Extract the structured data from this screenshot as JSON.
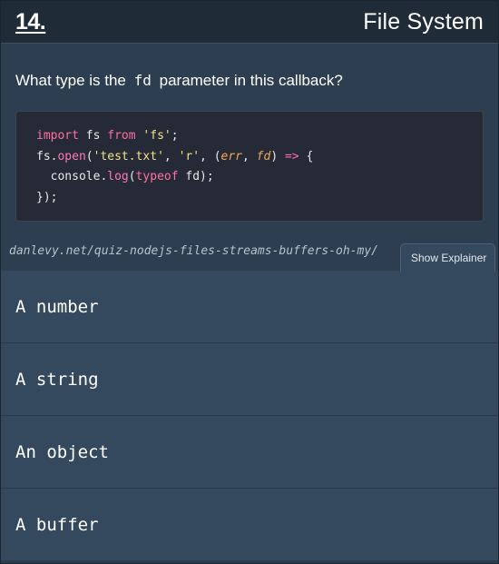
{
  "header": {
    "number": "14.",
    "topic": "File System"
  },
  "question": {
    "before": "What type is the",
    "code_term": "fd",
    "after": "parameter in this callback?"
  },
  "code": {
    "line1": {
      "kw1": "import",
      "mid1": " fs ",
      "kw2": "from",
      "sp": " ",
      "str": "'fs'",
      "end": ";"
    },
    "line2": {
      "obj": "fs.",
      "fn": "open",
      "p1": "(",
      "s1": "'test.txt'",
      "c1": ", ",
      "s2": "'r'",
      "c2": ", (",
      "a1": "err",
      "c3": ", ",
      "a2": "fd",
      "c4": ") ",
      "arrow": "=>",
      "end": " {"
    },
    "line3": {
      "indent": "  console.",
      "fn": "log",
      "p1": "(",
      "kw": "typeof",
      "rest": " fd);"
    },
    "line4": "});"
  },
  "source_link": "danlevy.net/quiz-nodejs-files-streams-buffers-oh-my/",
  "explainer_button": "Show Explainer",
  "answers": [
    "A number",
    "A string",
    "An object",
    "A buffer"
  ]
}
